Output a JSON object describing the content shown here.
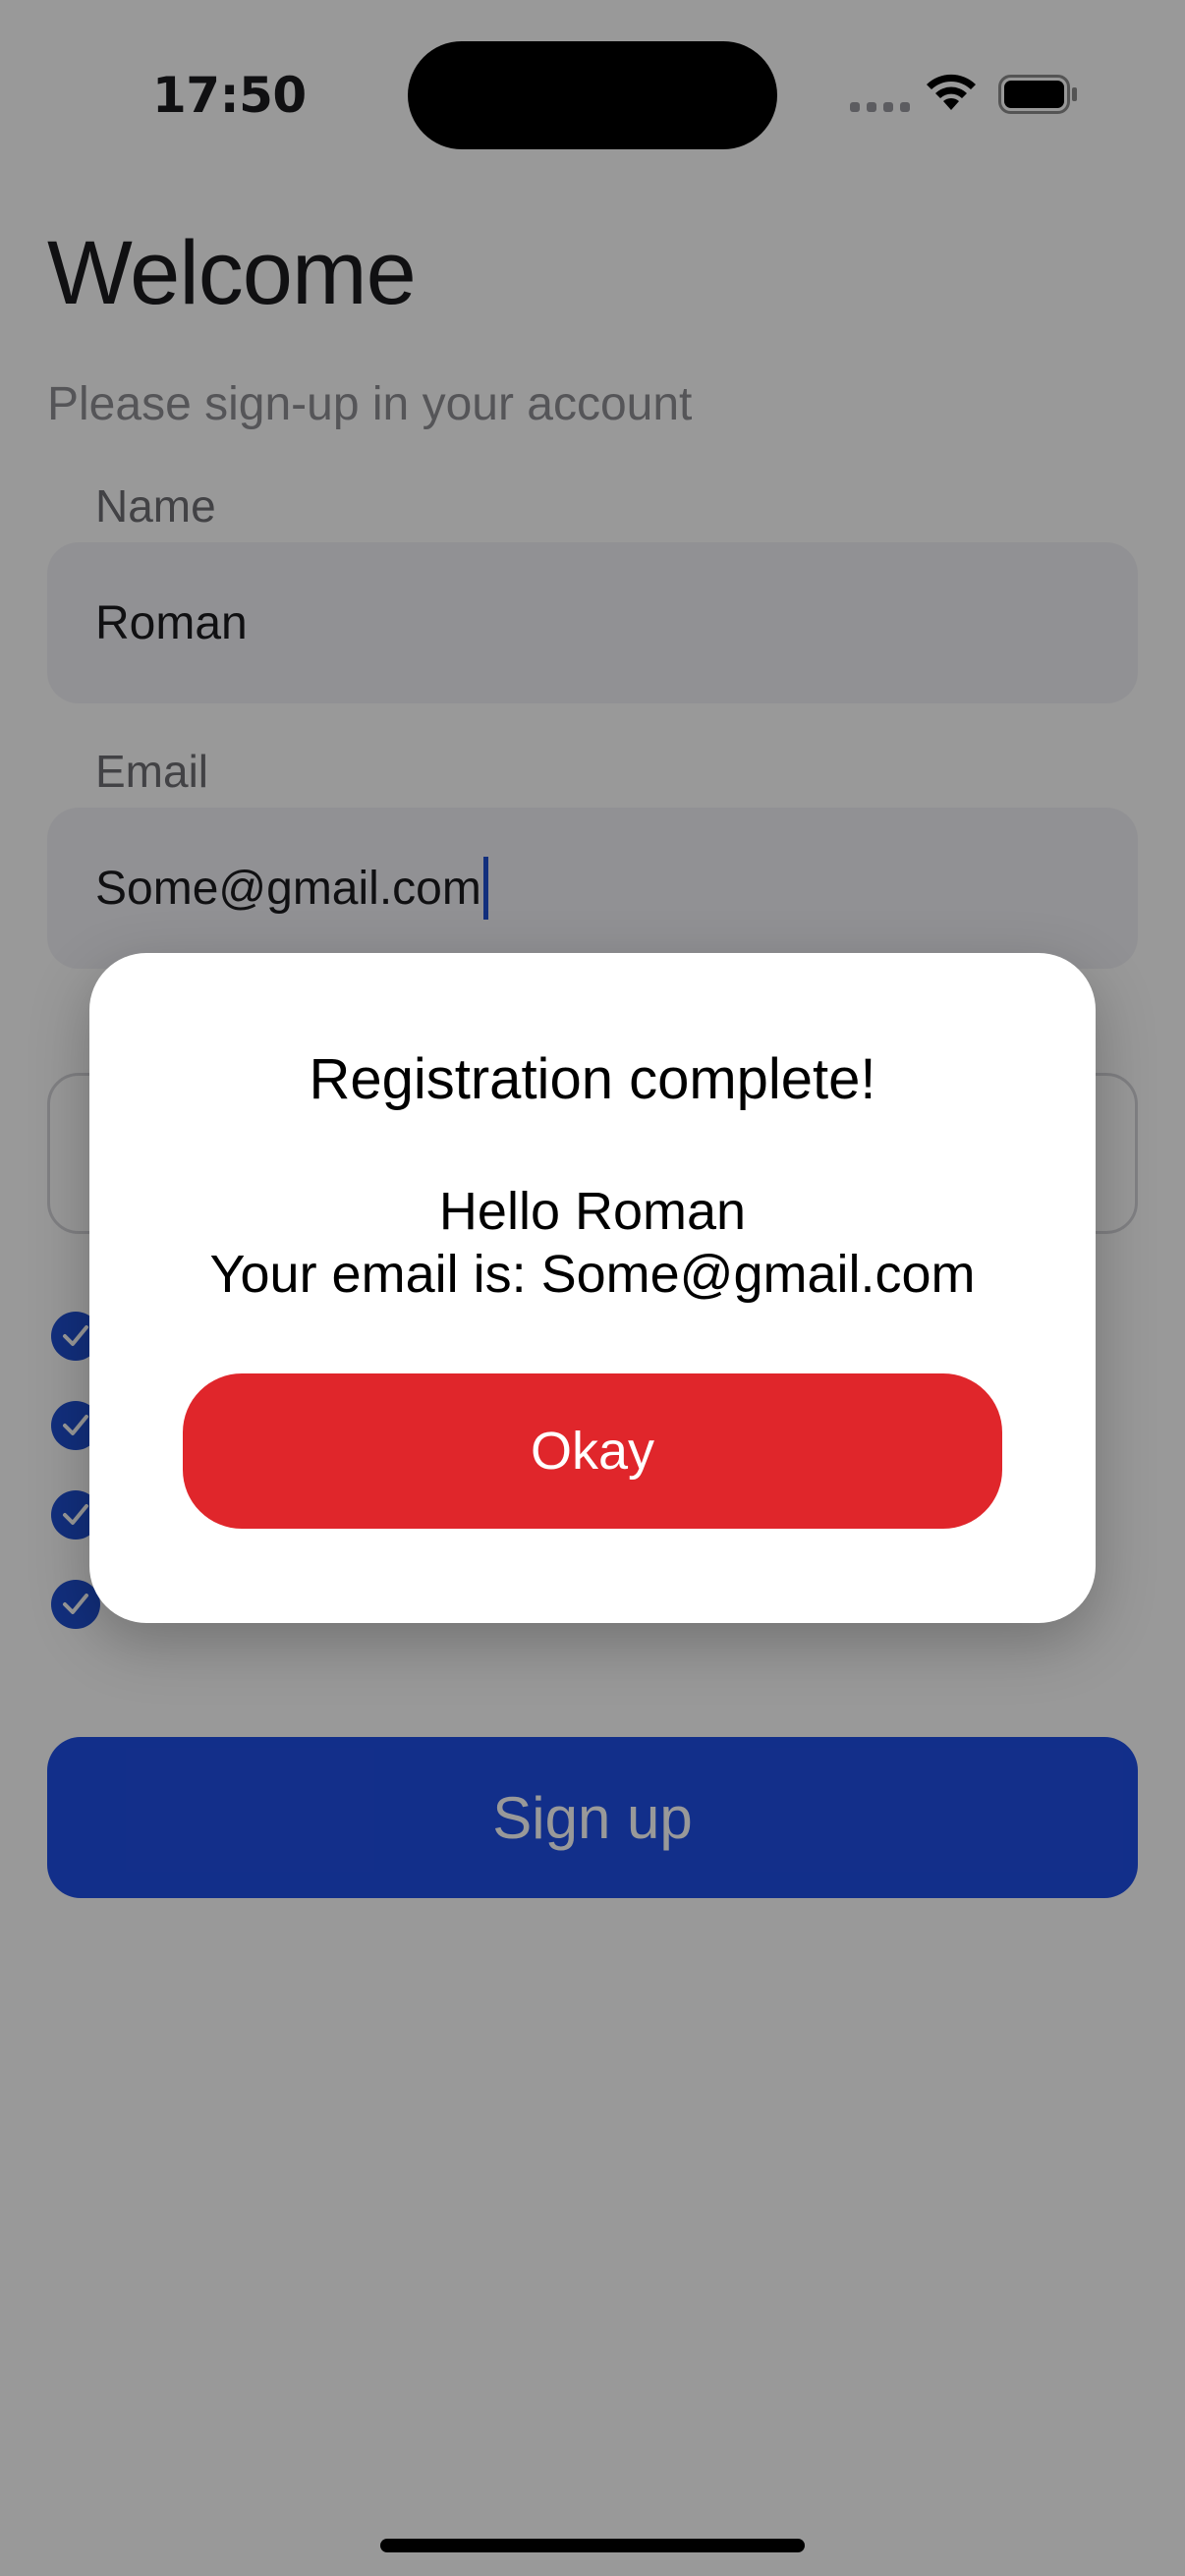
{
  "status_bar": {
    "time": "17:50",
    "signal_icon": "cellular-signal-icon",
    "wifi_icon": "wifi-icon",
    "battery_icon": "battery-icon"
  },
  "page": {
    "title": "Welcome",
    "subtitle": "Please sign-up in your account"
  },
  "form": {
    "name_label": "Name",
    "name_value": "Roman",
    "email_label": "Email",
    "email_value": "Some@gmail.com",
    "checkboxes": [
      {
        "checked": true
      },
      {
        "checked": true
      },
      {
        "checked": true
      },
      {
        "checked": true
      }
    ],
    "submit_label": "Sign up"
  },
  "dialog": {
    "title": "Registration complete!",
    "greeting": "Hello Roman",
    "email_line": "Your email is: Some@gmail.com",
    "button_label": "Okay"
  },
  "colors": {
    "accent": "#1f4fe6",
    "dialog_button": "#e0262b",
    "overlay": "rgba(0,0,0,0.40)"
  }
}
